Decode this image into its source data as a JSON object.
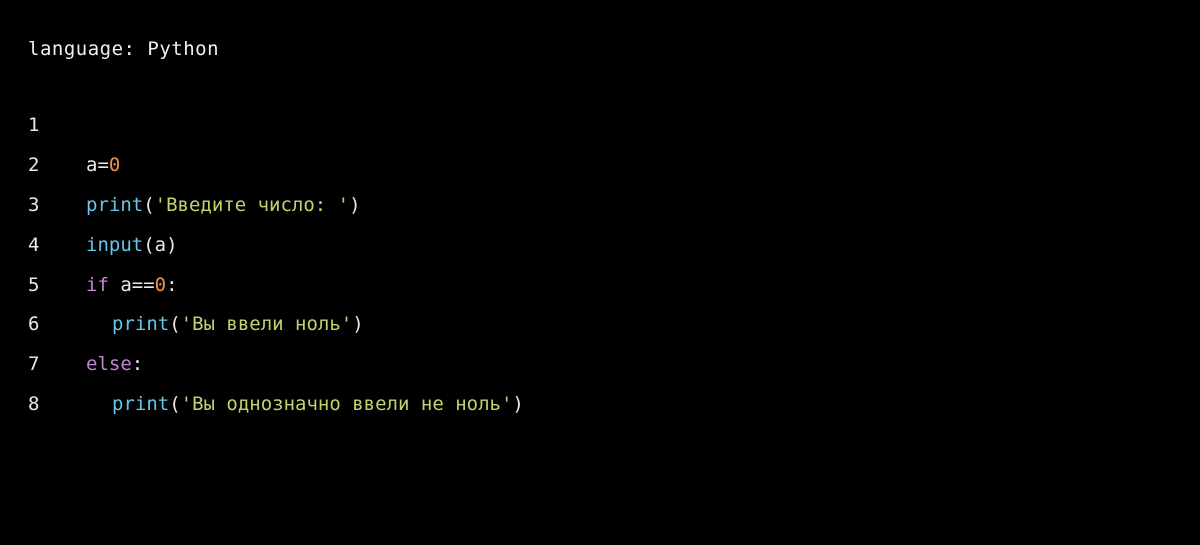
{
  "header": {
    "label": "language:",
    "value": "Python"
  },
  "colors": {
    "background": "#000000",
    "text": "#e8e8e8",
    "number": "#f09045",
    "function": "#66c5e8",
    "string": "#c5d06e",
    "keyword": "#c682d4"
  },
  "code": {
    "lines": [
      {
        "number": "1",
        "tokens": []
      },
      {
        "number": "2",
        "tokens": [
          {
            "type": "default",
            "text": "a="
          },
          {
            "type": "number",
            "text": "0"
          }
        ]
      },
      {
        "number": "3",
        "tokens": [
          {
            "type": "func",
            "text": "print"
          },
          {
            "type": "punct",
            "text": "("
          },
          {
            "type": "string",
            "text": "'Введите число: '"
          },
          {
            "type": "punct",
            "text": ")"
          }
        ]
      },
      {
        "number": "4",
        "tokens": [
          {
            "type": "func",
            "text": "input"
          },
          {
            "type": "punct",
            "text": "(a)"
          }
        ]
      },
      {
        "number": "5",
        "tokens": [
          {
            "type": "keyword",
            "text": "if"
          },
          {
            "type": "default",
            "text": " a=="
          },
          {
            "type": "number",
            "text": "0"
          },
          {
            "type": "punct",
            "text": ":"
          }
        ]
      },
      {
        "number": "6",
        "indent": 1,
        "tokens": [
          {
            "type": "func",
            "text": "print"
          },
          {
            "type": "punct",
            "text": "("
          },
          {
            "type": "string",
            "text": "'Вы ввели ноль'"
          },
          {
            "type": "punct",
            "text": ")"
          }
        ]
      },
      {
        "number": "7",
        "tokens": [
          {
            "type": "keyword",
            "text": "else"
          },
          {
            "type": "punct",
            "text": ":"
          }
        ]
      },
      {
        "number": "8",
        "indent": 1,
        "tokens": [
          {
            "type": "func",
            "text": "print"
          },
          {
            "type": "punct",
            "text": "("
          },
          {
            "type": "string",
            "text": "'Вы однозначно ввели не ноль'"
          },
          {
            "type": "punct",
            "text": ")"
          }
        ]
      }
    ]
  }
}
